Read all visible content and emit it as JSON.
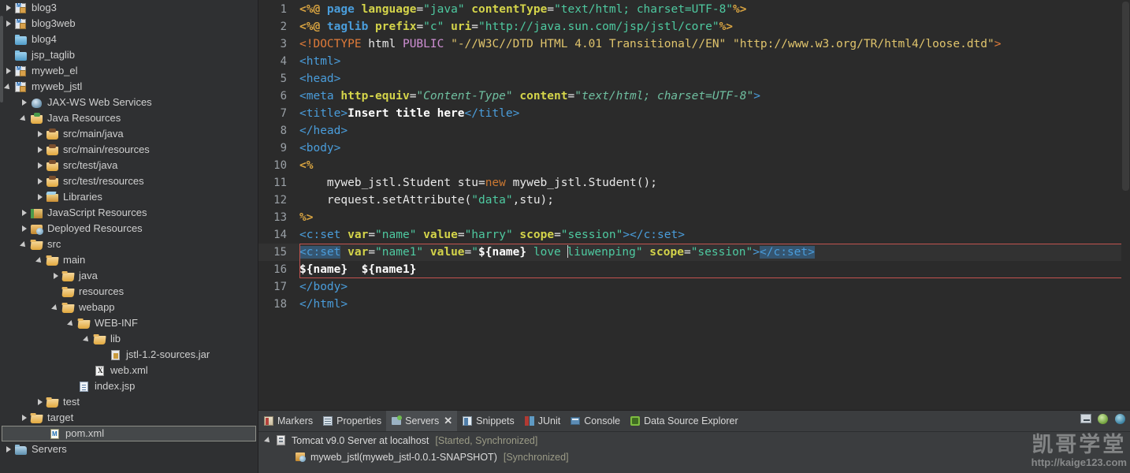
{
  "sidebar": {
    "name": "project-explorer",
    "items": [
      {
        "label": "blog3",
        "indent": 0,
        "arrow": "closed",
        "icon": "maven-project-icon"
      },
      {
        "label": "blog3web",
        "indent": 0,
        "arrow": "closed",
        "icon": "maven-project-icon"
      },
      {
        "label": "blog4",
        "indent": 0,
        "arrow": "none",
        "icon": "folder-blue-icon"
      },
      {
        "label": "jsp_taglib",
        "indent": 0,
        "arrow": "none",
        "icon": "folder-blue-icon"
      },
      {
        "label": "myweb_el",
        "indent": 0,
        "arrow": "closed",
        "icon": "maven-project-icon"
      },
      {
        "label": "myweb_jstl",
        "indent": 0,
        "arrow": "open",
        "icon": "maven-project-icon"
      },
      {
        "label": "JAX-WS Web Services",
        "indent": 1,
        "arrow": "closed",
        "icon": "jaxws-icon"
      },
      {
        "label": "Java Resources",
        "indent": 1,
        "arrow": "open",
        "icon": "java-resources-icon"
      },
      {
        "label": "src/main/java",
        "indent": 2,
        "arrow": "closed",
        "icon": "source-folder-icon"
      },
      {
        "label": "src/main/resources",
        "indent": 2,
        "arrow": "closed",
        "icon": "source-folder-icon"
      },
      {
        "label": "src/test/java",
        "indent": 2,
        "arrow": "closed",
        "icon": "source-folder-icon"
      },
      {
        "label": "src/test/resources",
        "indent": 2,
        "arrow": "closed",
        "icon": "source-folder-icon"
      },
      {
        "label": "Libraries",
        "indent": 2,
        "arrow": "closed",
        "icon": "libraries-icon"
      },
      {
        "label": "JavaScript Resources",
        "indent": 1,
        "arrow": "closed",
        "icon": "javascript-resources-icon"
      },
      {
        "label": "Deployed Resources",
        "indent": 1,
        "arrow": "closed",
        "icon": "deployed-resources-icon"
      },
      {
        "label": "src",
        "indent": 1,
        "arrow": "open",
        "icon": "folder-icon"
      },
      {
        "label": "main",
        "indent": 2,
        "arrow": "open",
        "icon": "folder-icon"
      },
      {
        "label": "java",
        "indent": 3,
        "arrow": "closed",
        "icon": "folder-icon"
      },
      {
        "label": "resources",
        "indent": 3,
        "arrow": "none",
        "icon": "folder-icon"
      },
      {
        "label": "webapp",
        "indent": 3,
        "arrow": "open",
        "icon": "folder-icon"
      },
      {
        "label": "WEB-INF",
        "indent": 4,
        "arrow": "open",
        "icon": "folder-icon"
      },
      {
        "label": "lib",
        "indent": 5,
        "arrow": "open",
        "icon": "folder-icon"
      },
      {
        "label": "jstl-1.2-sources.jar",
        "indent": 6,
        "arrow": "none",
        "icon": "jar-icon"
      },
      {
        "label": "web.xml",
        "indent": 5,
        "arrow": "none",
        "icon": "xml-file-icon"
      },
      {
        "label": "index.jsp",
        "indent": 4,
        "arrow": "none",
        "icon": "jsp-file-icon"
      },
      {
        "label": "test",
        "indent": 2,
        "arrow": "closed",
        "icon": "folder-icon"
      },
      {
        "label": "target",
        "indent": 1,
        "arrow": "closed",
        "icon": "folder-icon"
      },
      {
        "label": "pom.xml",
        "indent": 2,
        "arrow": "none",
        "icon": "pom-file-icon",
        "selected": true
      },
      {
        "label": "Servers",
        "indent": 0,
        "arrow": "closed",
        "icon": "servers-folder-icon"
      }
    ]
  },
  "editor": {
    "name": "jsp-source-editor",
    "current_line": 15,
    "lines": [
      {
        "n": "1",
        "marker": false
      },
      {
        "n": "2",
        "marker": false
      },
      {
        "n": "3",
        "marker": false
      },
      {
        "n": "4",
        "marker": true
      },
      {
        "n": "5",
        "marker": true
      },
      {
        "n": "6",
        "marker": false
      },
      {
        "n": "7",
        "marker": false
      },
      {
        "n": "8",
        "marker": false
      },
      {
        "n": "9",
        "marker": true
      },
      {
        "n": "10",
        "marker": true
      },
      {
        "n": "11",
        "marker": false
      },
      {
        "n": "12",
        "marker": false
      },
      {
        "n": "13",
        "marker": false
      },
      {
        "n": "14",
        "marker": false
      },
      {
        "n": "15",
        "marker": false
      },
      {
        "n": "16",
        "marker": false
      },
      {
        "n": "17",
        "marker": false
      },
      {
        "n": "18",
        "marker": false
      }
    ],
    "code": {
      "l1": "<%@ page language=\"java\" contentType=\"text/html; charset=UTF-8\"%>",
      "l2": "<%@ taglib prefix=\"c\" uri=\"http://java.sun.com/jsp/jstl/core\"%>",
      "l3": "<!DOCTYPE html PUBLIC \"-//W3C//DTD HTML 4.01 Transitional//EN\" \"http://www.w3.org/TR/html4/loose.dtd\">",
      "l4": "<html>",
      "l5": "<head>",
      "l6": "<meta http-equiv=\"Content-Type\" content=\"text/html; charset=UTF-8\">",
      "l7": "<title>Insert title here</title>",
      "l8": "</head>",
      "l9": "<body>",
      "l10": "<%",
      "l11": "    myweb_jstl.Student stu=new myweb_jstl.Student();",
      "l12": "    request.setAttribute(\"data\",stu);",
      "l13": "%>",
      "l14": "<c:set var=\"name\" value=\"harry\" scope=\"session\"></c:set>",
      "l15": "<c:set var=\"name1\" value=\"${name} love liuwenping\" scope=\"session\"></c:set>",
      "l16": "${name}  ${name1}",
      "l17": "</body>",
      "l18": "</html>"
    },
    "tokens": {
      "l1_a": "<%@",
      "l1_b": " page ",
      "l1_c": "language",
      "l1_d": "=",
      "l1_e": "\"java\"",
      "l1_f": " contentType",
      "l1_g": "=",
      "l1_h": "\"text/html; charset=UTF-8\"",
      "l1_i": "%>",
      "l2_a": "<%@",
      "l2_b": " taglib ",
      "l2_c": "prefix",
      "l2_d": "=",
      "l2_e": "\"c\"",
      "l2_f": " uri",
      "l2_g": "=",
      "l2_h": "\"http://java.sun.com/jsp/jstl/core\"",
      "l2_i": "%>",
      "l3_a": "<!DOCTYPE",
      "l3_b": " html ",
      "l3_c": "PUBLIC",
      "l3_d": " \"-//W3C//DTD HTML 4.01 Transitional//EN\"",
      "l3_e": " \"http://www.w3.org/TR/html4/loose.dtd\"",
      "l3_f": ">",
      "l4_a": "<html>",
      "l5_a": "<head>",
      "l6_a": "<meta",
      "l6_b": " http-equiv",
      "l6_c": "=",
      "l6_d": "\"Content-Type\"",
      "l6_e": " content",
      "l6_f": "=",
      "l6_g": "\"text/html; charset=UTF-8\"",
      "l6_h": ">",
      "l7_a": "<title>",
      "l7_b": "Insert title here",
      "l7_c": "</title>",
      "l8_a": "</head>",
      "l9_a": "<body>",
      "l10_a": "<%",
      "l11_a": "    myweb_jstl.Student stu=",
      "l11_b": "new",
      "l11_c": " myweb_jstl.Student();",
      "l12_a": "    request.setAttribute(",
      "l12_b": "\"data\"",
      "l12_c": ",stu);",
      "l13_a": "%>",
      "l14_a": "<c:set",
      "l14_b": " var",
      "l14_c": "=",
      "l14_d": "\"name\"",
      "l14_e": " value",
      "l14_f": "=",
      "l14_g": "\"harry\"",
      "l14_h": " scope",
      "l14_i": "=",
      "l14_j": "\"session\"",
      "l14_k": ">",
      "l14_l": "</c:set>",
      "l15_a": "<c:set",
      "l15_b": " var",
      "l15_c": "=",
      "l15_d": "\"name1\"",
      "l15_e": " value",
      "l15_f": "=",
      "l15_g": "\"",
      "l15_h": "${name}",
      "l15_i": " love ",
      "l15_j": "liuwenping",
      "l15_k": "\"",
      "l15_l": " scope",
      "l15_m": "=",
      "l15_n": "\"session\"",
      "l15_o": ">",
      "l15_p": "</c:set>",
      "l16_a": "${name}",
      "l16_b": "  ",
      "l16_c": "${name1}",
      "l17_a": "</body>",
      "l18_a": "</html>"
    }
  },
  "bottom_panel": {
    "name": "views-panel",
    "tabs": [
      {
        "label": "Markers",
        "icon": "markers-icon",
        "active": false,
        "closable": false
      },
      {
        "label": "Properties",
        "icon": "properties-icon",
        "active": false,
        "closable": false
      },
      {
        "label": "Servers",
        "icon": "servers-icon",
        "active": true,
        "closable": true
      },
      {
        "label": "Snippets",
        "icon": "snippets-icon",
        "active": false,
        "closable": false
      },
      {
        "label": "JUnit",
        "icon": "junit-icon",
        "active": false,
        "closable": false
      },
      {
        "label": "Console",
        "icon": "console-icon",
        "active": false,
        "closable": false
      },
      {
        "label": "Data Source Explorer",
        "icon": "database-icon",
        "active": false,
        "closable": false
      }
    ],
    "close_glyph": "✕",
    "tools": [
      "minimize-icon",
      "maximize-icon",
      "restore-icon"
    ],
    "rows": [
      {
        "name": "server-row",
        "arrow": "open",
        "icon": "tomcat-server-icon",
        "label": "Tomcat v9.0 Server at localhost",
        "status": "[Started, Synchronized]",
        "indent": 0
      },
      {
        "name": "module-row",
        "arrow": "none",
        "icon": "deployed-module-icon",
        "label": "myweb_jstl(myweb_jstl-0.0.1-SNAPSHOT)",
        "status": "[Synchronized]",
        "indent": 1
      }
    ]
  },
  "watermark": {
    "name": "watermark",
    "text_cn": "凯哥学堂",
    "url": "http://kaige123.com"
  },
  "colors": {
    "sidebar_bg": "#2f3032",
    "editor_bg": "#2b2b2b",
    "panel_bg": "#3b3d3f",
    "accent_red_box": "#c2534f",
    "tag_blue": "#4a9ddb",
    "attr_yellow": "#d4d44a",
    "string_green": "#4ec9a0",
    "jsp_orange": "#d9a441"
  }
}
